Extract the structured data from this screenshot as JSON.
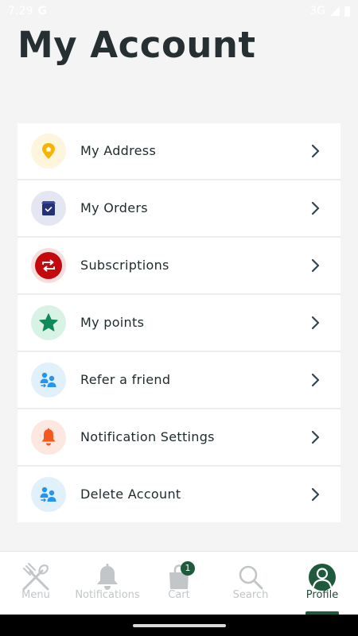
{
  "status_bar": {
    "time": "7:29",
    "network": "3G"
  },
  "page": {
    "title": "My Account"
  },
  "menu": {
    "items": [
      {
        "label": "My Address",
        "icon": "location-pin-icon",
        "bg": "#fdf5dc",
        "color": "#f5b400"
      },
      {
        "label": "My Orders",
        "icon": "package-icon",
        "bg": "#e4e6f1",
        "color": "#23307a"
      },
      {
        "label": "Subscriptions",
        "icon": "repeat-icon",
        "bg": "#f6dedf",
        "color": "#c3080e"
      },
      {
        "label": "My points",
        "icon": "star-icon",
        "bg": "#d8f2e6",
        "color": "#0f8a5a"
      },
      {
        "label": "Refer a friend",
        "icon": "people-icon",
        "bg": "#e1f1fc",
        "color": "#2196f3"
      },
      {
        "label": "Notification Settings",
        "icon": "bell-icon",
        "bg": "#fde8e1",
        "color": "#f4581e"
      },
      {
        "label": "Delete Account",
        "icon": "people-icon",
        "bg": "#e1f1fc",
        "color": "#2196f3"
      }
    ]
  },
  "bottom_nav": {
    "items": [
      {
        "label": "Menu",
        "icon": "fork-knife-icon"
      },
      {
        "label": "Notifications",
        "icon": "bell-icon"
      },
      {
        "label": "Cart",
        "icon": "shopping-bag-icon",
        "badge": "1"
      },
      {
        "label": "Search",
        "icon": "search-icon"
      },
      {
        "label": "Profile",
        "icon": "profile-icon",
        "active": true
      }
    ]
  },
  "colors": {
    "accent": "#1e5a3c",
    "chevron": "#2e4856",
    "inactive_nav": "#c2c6c8"
  }
}
